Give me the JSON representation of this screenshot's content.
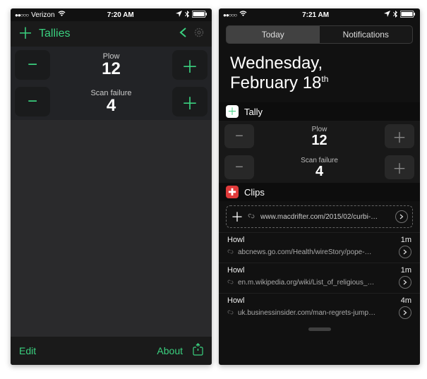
{
  "left": {
    "status": {
      "carrier": "Verizon",
      "time": "7:20 AM"
    },
    "header": {
      "title": "Tallies"
    },
    "tallies": [
      {
        "label": "Plow",
        "value": "12"
      },
      {
        "label": "Scan failure",
        "value": "4"
      }
    ],
    "footer": {
      "edit": "Edit",
      "about": "About"
    }
  },
  "right": {
    "status": {
      "time": "7:21 AM"
    },
    "segments": {
      "today": "Today",
      "notifications": "Notifications"
    },
    "date": {
      "line1": "Wednesday,",
      "line2_pre": "February 18",
      "line2_suf": "th"
    },
    "widgets": {
      "tally": {
        "name": "Tally",
        "rows": [
          {
            "label": "Plow",
            "value": "12"
          },
          {
            "label": "Scan failure",
            "value": "4"
          }
        ]
      },
      "clips": {
        "name": "Clips",
        "new_url": "www.macdrifter.com/2015/02/curbi-…",
        "items": [
          {
            "title": "Howl",
            "age": "1m",
            "url": "abcnews.go.com/Health/wireStory/pope-…"
          },
          {
            "title": "Howl",
            "age": "1m",
            "url": "en.m.wikipedia.org/wiki/List_of_religious_…"
          },
          {
            "title": "Howl",
            "age": "4m",
            "url": "uk.businessinsider.com/man-regrets-jump…"
          }
        ]
      }
    }
  }
}
